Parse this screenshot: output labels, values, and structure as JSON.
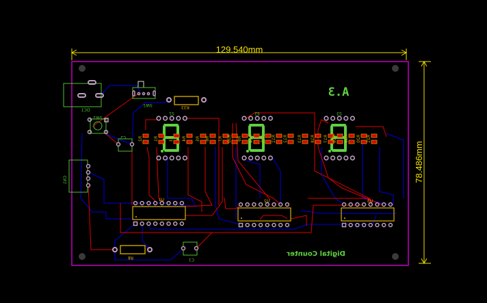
{
  "dimensions": {
    "width_label": "129.540mm",
    "height_label": "78.486mm"
  },
  "board": {
    "outline_color": "#c000c0",
    "title_text": "Digital Counter",
    "marking_text": "A.3",
    "mirrored_view": true
  },
  "colors": {
    "top_copper": "#e00000",
    "bottom_copper": "#0000e0",
    "silkscreen_green": "#50c030",
    "silkscreen_yellow": "#e0b000",
    "pad_ring": "#c0a0c0",
    "dimension": "#f0e000"
  },
  "components": {
    "DC1": "DC1",
    "SW1": "SW1",
    "SW2": "SW2",
    "R33": "R33",
    "C1": "C1",
    "C2": "C2",
    "R8": "R8",
    "CN1": "CN1",
    "S1": "S1",
    "S2": "S2",
    "S3": "S3",
    "U1": "U1",
    "U2": "U2",
    "U3": "U3"
  },
  "resistors": [
    "R2",
    "R1",
    "R3",
    "R4",
    "R5",
    "R6",
    "R7",
    "R10",
    "R9",
    "R14",
    "R15",
    "R11",
    "R12",
    "R13",
    "R18",
    "R17",
    "R16",
    "R19",
    "R20",
    "R21"
  ]
}
